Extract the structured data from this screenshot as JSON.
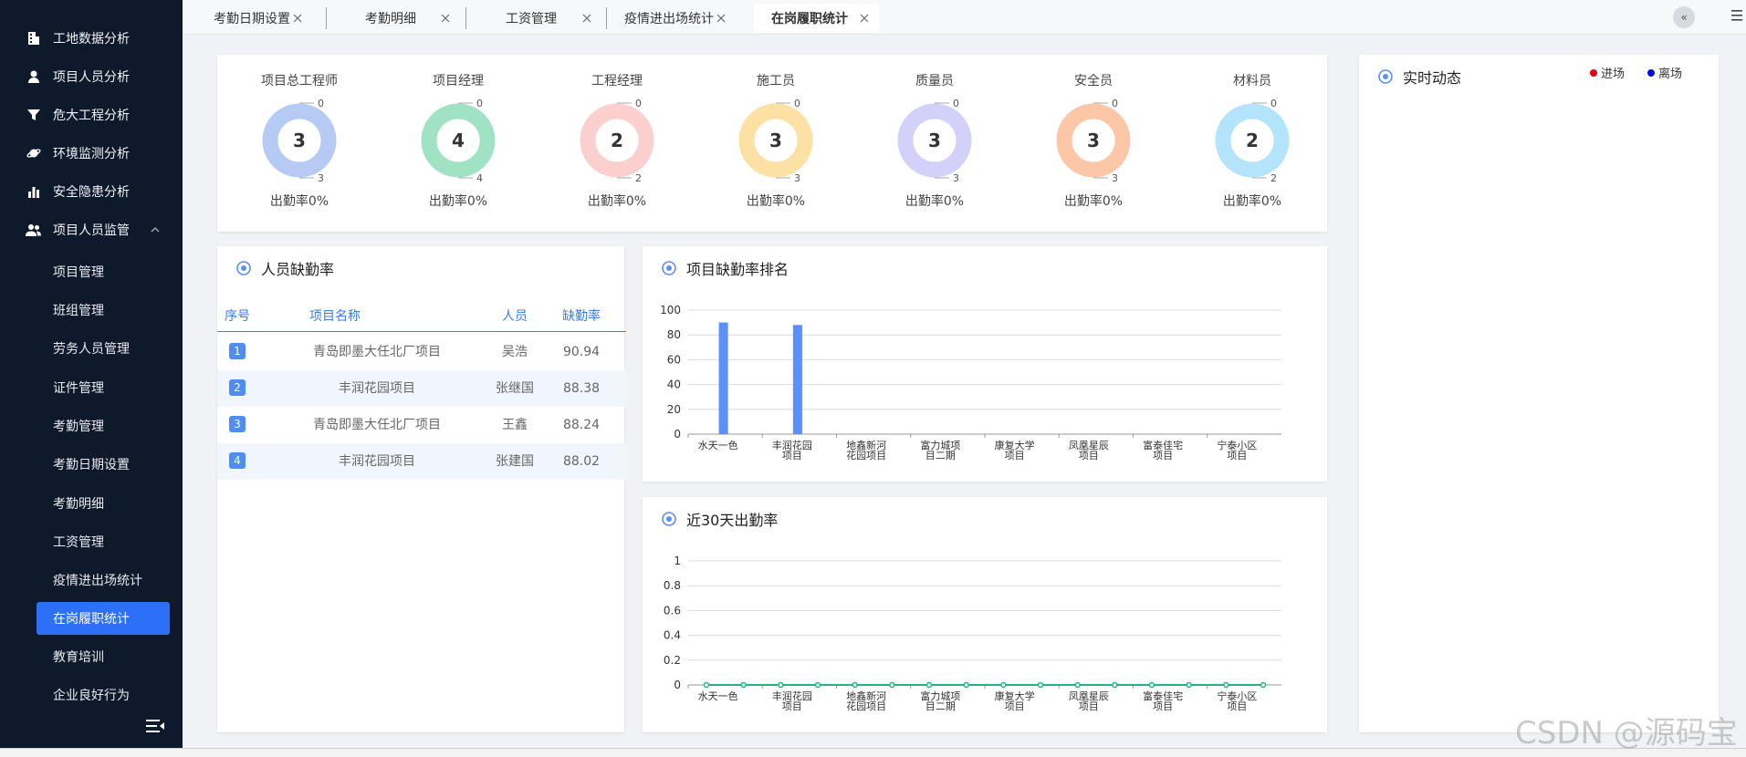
{
  "sidebar": {
    "items": [
      {
        "label": "工地数据分析",
        "icon": "building-icon"
      },
      {
        "label": "项目人员分析",
        "icon": "person-icon"
      },
      {
        "label": "危大工程分析",
        "icon": "funnel-icon"
      },
      {
        "label": "环境监测分析",
        "icon": "planet-icon"
      },
      {
        "label": "安全隐患分析",
        "icon": "bar-chart-icon"
      },
      {
        "label": "项目人员监管",
        "icon": "people-icon"
      }
    ],
    "subitems": [
      {
        "label": "项目管理"
      },
      {
        "label": "班组管理"
      },
      {
        "label": "劳务人员管理"
      },
      {
        "label": "证件管理"
      },
      {
        "label": "考勤管理"
      },
      {
        "label": "考勤日期设置"
      },
      {
        "label": "考勤明细"
      },
      {
        "label": "工资管理"
      },
      {
        "label": "疫情进出场统计"
      },
      {
        "label": "在岗履职统计"
      },
      {
        "label": "教育培训"
      },
      {
        "label": "企业良好行为"
      }
    ],
    "active_subitem": "在岗履职统计"
  },
  "tabs": [
    {
      "label": "考勤日期设置"
    },
    {
      "label": "考勤明细"
    },
    {
      "label": "工资管理"
    },
    {
      "label": "疫情进出场统计"
    },
    {
      "label": "在岗履职统计"
    }
  ],
  "tab_collapse_label": "«",
  "roles": [
    {
      "name": "项目总工程师",
      "total": "3",
      "top_label": "0",
      "bottom_label": "3",
      "rate": "出勤率0%",
      "color": "#b5cbf3"
    },
    {
      "name": "项目经理",
      "total": "4",
      "top_label": "0",
      "bottom_label": "4",
      "rate": "出勤率0%",
      "color": "#9fe3c4"
    },
    {
      "name": "工程经理",
      "total": "2",
      "top_label": "0",
      "bottom_label": "2",
      "rate": "出勤率0%",
      "color": "#fccfcf"
    },
    {
      "name": "施工员",
      "total": "3",
      "top_label": "0",
      "bottom_label": "3",
      "rate": "出勤率0%",
      "color": "#fde0a3"
    },
    {
      "name": "质量员",
      "total": "3",
      "top_label": "0",
      "bottom_label": "3",
      "rate": "出勤率0%",
      "color": "#d3d1fa"
    },
    {
      "name": "安全员",
      "total": "3",
      "top_label": "0",
      "bottom_label": "3",
      "rate": "出勤率0%",
      "color": "#fcc7a6"
    },
    {
      "name": "材料员",
      "total": "2",
      "top_label": "0",
      "bottom_label": "2",
      "rate": "出勤率0%",
      "color": "#b3e4fb"
    }
  ],
  "absence_table": {
    "title": "人员缺勤率",
    "headers": [
      "序号",
      "项目名称",
      "人员",
      "缺勤率"
    ],
    "rows": [
      {
        "rank": "1",
        "project": "青岛即墨大任北厂项目",
        "person": "吴浩",
        "rate": "90.94"
      },
      {
        "rank": "2",
        "project": "丰润花园项目",
        "person": "张继国",
        "rate": "88.38"
      },
      {
        "rank": "3",
        "project": "青岛即墨大任北厂项目",
        "person": "王鑫",
        "rate": "88.24"
      },
      {
        "rank": "4",
        "project": "丰润花园项目",
        "person": "张建国",
        "rate": "88.02"
      }
    ]
  },
  "realtime": {
    "title": "实时动态",
    "legend_in": "进场",
    "legend_out": "离场",
    "legend_in_color": "#e8000b",
    "legend_out_color": "#0010d8"
  },
  "chart_data": [
    {
      "type": "bar",
      "title": "项目缺勤率排名",
      "categories": [
        "水天一色",
        "丰润花园\n项目",
        "地鑫新河\n花园项目",
        "富力城项\n目二期",
        "康复大学\n项目",
        "凤凰星辰\n项目",
        "富泰佳宅\n项目",
        "宁泰小区\n项目"
      ],
      "values": [
        90,
        88,
        0,
        0,
        0,
        0,
        0,
        0
      ],
      "yticks": [
        "100",
        "80",
        "60",
        "40",
        "20",
        "0"
      ],
      "ylim": [
        0,
        100
      ],
      "color": "#5b8ff9",
      "grid": true
    },
    {
      "type": "line",
      "title": "近30天出勤率",
      "categories": [
        "水天一色",
        "丰润花园\n项目",
        "地鑫新河\n花园项目",
        "富力城项\n目二期",
        "康复大学\n项目",
        "凤凰星辰\n项目",
        "富泰佳宅\n项目",
        "宁泰小区\n项目"
      ],
      "values": [
        0,
        0,
        0,
        0,
        0,
        0,
        0,
        0,
        0,
        0,
        0,
        0,
        0,
        0,
        0,
        0
      ],
      "yticks": [
        "1",
        "0.8",
        "0.6",
        "0.4",
        "0.2",
        "0"
      ],
      "ylim": [
        0,
        1
      ],
      "color": "#2ab27b",
      "grid": true
    }
  ],
  "watermark": "CSDN @源码宝"
}
